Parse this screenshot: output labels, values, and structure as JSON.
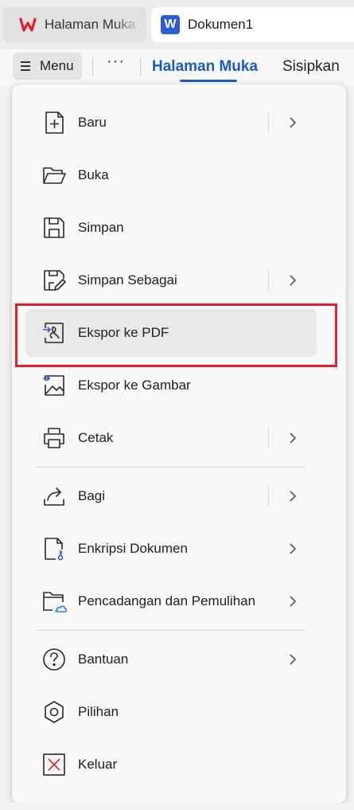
{
  "tabs": {
    "home_label": "Halaman Muka",
    "doc_label": "Dokumen1",
    "doc_logo_letter": "W"
  },
  "ribbon": {
    "menu_label": "Menu",
    "more_label": "···",
    "active_tab": "Halaman Muka",
    "next_tab": "Sisipkan"
  },
  "menu": {
    "items": [
      {
        "label": "Baru",
        "icon": "new-file-icon",
        "submenu": true,
        "separator": true
      },
      {
        "label": "Buka",
        "icon": "open-folder-icon",
        "submenu": false
      },
      {
        "label": "Simpan",
        "icon": "save-icon",
        "submenu": false
      },
      {
        "label": "Simpan Sebagai",
        "icon": "save-as-icon",
        "submenu": true,
        "separator": true
      },
      {
        "label": "Ekspor ke PDF",
        "icon": "export-pdf-icon",
        "submenu": false,
        "highlighted": true
      },
      {
        "label": "Ekspor ke Gambar",
        "icon": "export-image-icon",
        "submenu": false
      },
      {
        "label": "Cetak",
        "icon": "print-icon",
        "submenu": true,
        "separator": true
      },
      {
        "label": "Bagi",
        "icon": "share-icon",
        "submenu": true,
        "separator": true
      },
      {
        "label": "Enkripsi Dokumen",
        "icon": "encrypt-document-icon",
        "submenu": true
      },
      {
        "label": "Pencadangan dan Pemulihan",
        "icon": "backup-restore-icon",
        "submenu": true
      },
      {
        "label": "Bantuan",
        "icon": "help-icon",
        "submenu": true
      },
      {
        "label": "Pilihan",
        "icon": "options-icon",
        "submenu": false
      },
      {
        "label": "Keluar",
        "icon": "exit-icon",
        "submenu": false
      }
    ]
  },
  "colors": {
    "accent_blue": "#1c5bbf",
    "wps_red": "#e0202a",
    "highlight_border": "#e0202a",
    "exit_icon_red": "#d9262c",
    "cloud_blue": "#2b7de9"
  }
}
